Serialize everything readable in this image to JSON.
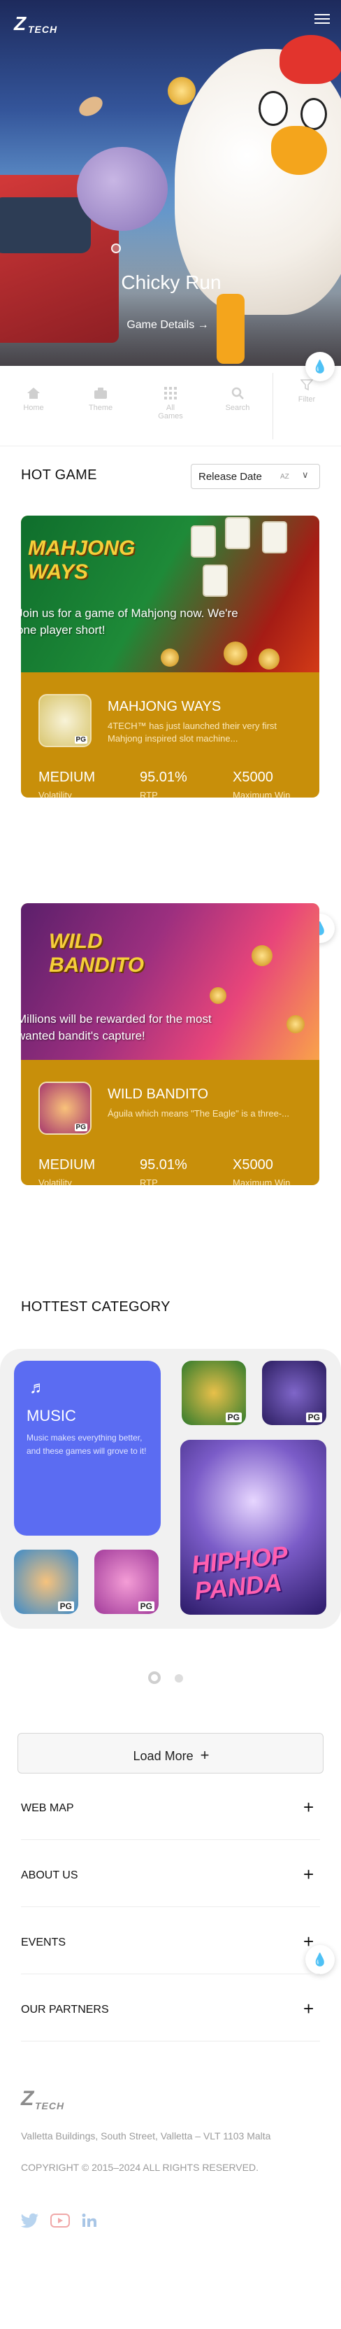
{
  "brand": {
    "logo_mark": "Z",
    "logo_text": "TECH"
  },
  "header": {
    "menu_icon": "hamburger-menu-icon"
  },
  "hero": {
    "title": "Chicky Run",
    "details_link": "Game Details →"
  },
  "filters": [
    {
      "label": "Home",
      "icon": "home-icon"
    },
    {
      "label": "Theme",
      "icon": "theme-icon"
    },
    {
      "label": "All Games",
      "icon": "grid-icon"
    },
    {
      "label": "Search",
      "icon": "search-icon"
    },
    {
      "label": "Filter",
      "icon": "filter-icon"
    }
  ],
  "hot_game": {
    "heading": "HOT GAME",
    "sort": {
      "selected": "Release Date",
      "az": "AZ",
      "chevron": "∨"
    }
  },
  "games": [
    {
      "name": "MAHJONG WAYS",
      "description": "4TECH™ has just launched their very first Mahjong inspired slot machine...",
      "art_logo": "MAHJONG WAYS",
      "art_caption": "Join us for a game of Mahjong now. We're one player short!",
      "thumb_badge": "PG",
      "stats": [
        {
          "value": "MEDIUM",
          "label": "Volatility"
        },
        {
          "value": "95.01%",
          "label": "RTP"
        },
        {
          "value": "X5000",
          "label": "Maximum Win"
        }
      ]
    },
    {
      "name": "WILD BANDITO",
      "description": "Águila which means \"The Eagle\" is a three-...",
      "art_logo": "WILD BANDITO",
      "art_caption": "Millions will be rewarded for the most wanted bandit's capture!",
      "thumb_badge": "PG",
      "stats": [
        {
          "value": "MEDIUM",
          "label": "Volatility"
        },
        {
          "value": "95.01%",
          "label": "RTP"
        },
        {
          "value": "X5000",
          "label": "Maximum Win"
        }
      ]
    }
  ],
  "category": {
    "heading": "HOTTEST CATEGORY",
    "music": {
      "title": "MUSIC",
      "description": "Music makes everything better, and these games will grove to it!",
      "icon": "music-note-icon"
    },
    "featured_art_text": "HIPHOP PANDA",
    "pg_badge": "PG"
  },
  "load_more": {
    "label": "Load More",
    "icon": "+"
  },
  "accordion": [
    {
      "label": "WEB MAP",
      "icon": "+"
    },
    {
      "label": "ABOUT US",
      "icon": "+"
    },
    {
      "label": "EVENTS",
      "icon": "+"
    },
    {
      "label": "OUR PARTNERS",
      "icon": "+"
    }
  ],
  "footer": {
    "address": "Valletta Buildings, South Street, Valletta – VLT 1103 Malta",
    "copyright": "COPYRIGHT © 2015–2024 ALL RIGHTS RESERVED.",
    "social": [
      "twitter-icon",
      "youtube-icon",
      "linkedin-icon"
    ]
  },
  "colors": {
    "card_gold": "#c88f0a",
    "music_blue": "#5b6cf2",
    "float_icon": "#2a86e6"
  }
}
